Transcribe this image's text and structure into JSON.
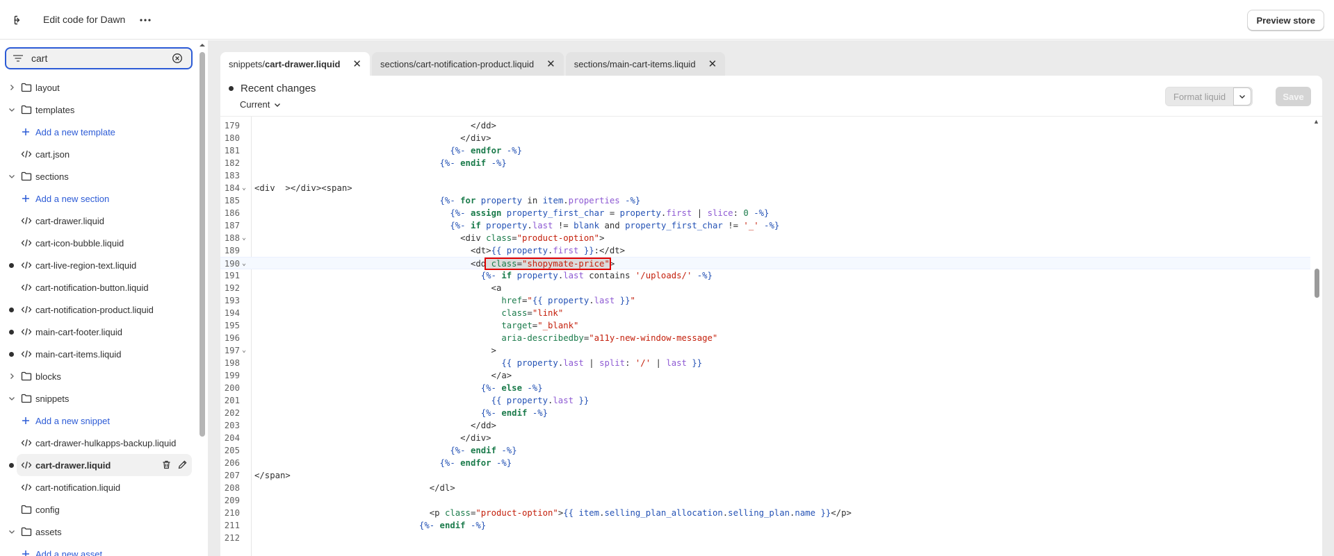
{
  "topbar": {
    "title": "Edit code for Dawn",
    "more_label": "···",
    "preview_label": "Preview store"
  },
  "sidebar": {
    "search_value": "cart",
    "items": [
      {
        "type": "folder",
        "label": "layout",
        "expanded": false,
        "dot": false
      },
      {
        "type": "folder",
        "label": "templates",
        "expanded": true,
        "dot": false
      },
      {
        "type": "add",
        "label": "Add a new template",
        "dot": false
      },
      {
        "type": "file",
        "label": "cart.json",
        "dot": false
      },
      {
        "type": "folder",
        "label": "sections",
        "expanded": true,
        "dot": false
      },
      {
        "type": "add",
        "label": "Add a new section",
        "dot": false
      },
      {
        "type": "file",
        "label": "cart-drawer.liquid",
        "dot": false
      },
      {
        "type": "file",
        "label": "cart-icon-bubble.liquid",
        "dot": false
      },
      {
        "type": "file",
        "label": "cart-live-region-text.liquid",
        "dot": true
      },
      {
        "type": "file",
        "label": "cart-notification-button.liquid",
        "dot": false
      },
      {
        "type": "file",
        "label": "cart-notification-product.liquid",
        "dot": true
      },
      {
        "type": "file",
        "label": "main-cart-footer.liquid",
        "dot": true
      },
      {
        "type": "file",
        "label": "main-cart-items.liquid",
        "dot": true
      },
      {
        "type": "folder",
        "label": "blocks",
        "expanded": false,
        "dot": false
      },
      {
        "type": "folder",
        "label": "snippets",
        "expanded": true,
        "dot": false
      },
      {
        "type": "add",
        "label": "Add a new snippet",
        "dot": false
      },
      {
        "type": "file",
        "label": "cart-drawer-hulkapps-backup.liquid",
        "dot": false
      },
      {
        "type": "file",
        "label": "cart-drawer.liquid",
        "dot": true,
        "active": true
      },
      {
        "type": "file",
        "label": "cart-notification.liquid",
        "dot": false
      },
      {
        "type": "folder",
        "label": "config",
        "expanded": null,
        "dot": false
      },
      {
        "type": "folder",
        "label": "assets",
        "expanded": true,
        "dot": false
      },
      {
        "type": "add",
        "label": "Add a new asset",
        "dot": false
      }
    ]
  },
  "tabs": [
    {
      "prefix": "snippets/",
      "name": "cart-drawer.liquid",
      "active": true
    },
    {
      "prefix": "sections/",
      "name": "cart-notification-product.liquid",
      "active": false
    },
    {
      "prefix": "sections/",
      "name": "main-cart-items.liquid",
      "active": false
    }
  ],
  "editor": {
    "recent_changes": "Recent changes",
    "current_label": "Current",
    "format_label": "Format liquid",
    "save_label": "Save",
    "lines": [
      {
        "n": "179",
        "fold": false,
        "html": "                                          &lt;/dd&gt;"
      },
      {
        "n": "180",
        "fold": false,
        "html": "                                        &lt;/div&gt;"
      },
      {
        "n": "181",
        "fold": false,
        "html": "                                      <span class=\"d\">{%-</span> <span class=\"k\">endfor</span> <span class=\"d\">-%}</span>"
      },
      {
        "n": "182",
        "fold": false,
        "html": "                                    <span class=\"d\">{%-</span> <span class=\"k\">endif</span> <span class=\"d\">-%}</span>"
      },
      {
        "n": "183",
        "fold": false,
        "html": ""
      },
      {
        "n": "184",
        "fold": true,
        "html": "&lt;div  &gt;&lt;/div&gt;&lt;span&gt;"
      },
      {
        "n": "185",
        "fold": false,
        "html": "                                    <span class=\"d\">{%-</span> <span class=\"k\">for</span> <span class=\"d\">property</span> in <span class=\"d\">item</span>.<span class=\"p\">properties</span> <span class=\"d\">-%}</span>"
      },
      {
        "n": "186",
        "fold": false,
        "html": "                                      <span class=\"d\">{%-</span> <span class=\"k\">assign</span> <span class=\"d\">property_first_char</span> = <span class=\"d\">property</span>.<span class=\"p\">first</span> | <span class=\"p\">slice</span>: <span class=\"a\">0</span> <span class=\"d\">-%}</span>"
      },
      {
        "n": "187",
        "fold": false,
        "html": "                                      <span class=\"d\">{%-</span> <span class=\"k\">if</span> <span class=\"d\">property</span>.<span class=\"p\">last</span> != <span class=\"d\">blank</span> and <span class=\"d\">property_first_char</span> != <span class=\"s\">'_'</span> <span class=\"d\">-%}</span>"
      },
      {
        "n": "188",
        "fold": true,
        "html": "                                        &lt;div <span class=\"a\">class</span>=<span class=\"s\">\"product-option\"</span>&gt;"
      },
      {
        "n": "189",
        "fold": false,
        "html": "                                          &lt;dt&gt;<span class=\"d\">{{ property</span>.<span class=\"p\">first</span> <span class=\"d\">}}</span>:&lt;/dt&gt;"
      },
      {
        "n": "190",
        "fold": true,
        "hl": true,
        "html": "                                          &lt;dd<span class=\"sel\"> <span class=\"a\">class</span>=<span class=\"s\">\"shopymate-price\"</span></span>&gt;"
      },
      {
        "n": "191",
        "fold": false,
        "html": "                                            <span class=\"d\">{%-</span> <span class=\"k\">if</span> <span class=\"d\">property</span>.<span class=\"p\">last</span> contains <span class=\"s\">'/uploads/'</span> <span class=\"d\">-%}</span>"
      },
      {
        "n": "192",
        "fold": false,
        "html": "                                              &lt;a"
      },
      {
        "n": "193",
        "fold": false,
        "html": "                                                <span class=\"a\">href</span>=<span class=\"s\">\"</span><span class=\"d\">{{ property</span>.<span class=\"p\">last</span> <span class=\"d\">}}</span><span class=\"s\">\"</span>"
      },
      {
        "n": "194",
        "fold": false,
        "html": "                                                <span class=\"a\">class</span>=<span class=\"s\">\"link\"</span>"
      },
      {
        "n": "195",
        "fold": false,
        "html": "                                                <span class=\"a\">target</span>=<span class=\"s\">\"_blank\"</span>"
      },
      {
        "n": "196",
        "fold": false,
        "html": "                                                <span class=\"a\">aria-describedby</span>=<span class=\"s\">\"a11y-new-window-message\"</span>"
      },
      {
        "n": "197",
        "fold": true,
        "html": "                                              &gt;"
      },
      {
        "n": "198",
        "fold": false,
        "html": "                                                <span class=\"d\">{{ property</span>.<span class=\"p\">last</span> | <span class=\"p\">split</span>: <span class=\"s\">'/'</span> | <span class=\"p\">last</span> <span class=\"d\">}}</span>"
      },
      {
        "n": "199",
        "fold": false,
        "html": "                                              &lt;/a&gt;"
      },
      {
        "n": "200",
        "fold": false,
        "html": "                                            <span class=\"d\">{%-</span> <span class=\"k\">else</span> <span class=\"d\">-%}</span>"
      },
      {
        "n": "201",
        "fold": false,
        "html": "                                              <span class=\"d\">{{ property</span>.<span class=\"p\">last</span> <span class=\"d\">}}</span>"
      },
      {
        "n": "202",
        "fold": false,
        "html": "                                            <span class=\"d\">{%-</span> <span class=\"k\">endif</span> <span class=\"d\">-%}</span>"
      },
      {
        "n": "203",
        "fold": false,
        "html": "                                          &lt;/dd&gt;"
      },
      {
        "n": "204",
        "fold": false,
        "html": "                                        &lt;/div&gt;"
      },
      {
        "n": "205",
        "fold": false,
        "html": "                                      <span class=\"d\">{%-</span> <span class=\"k\">endif</span> <span class=\"d\">-%}</span>"
      },
      {
        "n": "206",
        "fold": false,
        "html": "                                    <span class=\"d\">{%-</span> <span class=\"k\">endfor</span> <span class=\"d\">-%}</span>"
      },
      {
        "n": "207",
        "fold": false,
        "html": "&lt;/span&gt;"
      },
      {
        "n": "208",
        "fold": false,
        "html": "                                  &lt;/dl&gt;"
      },
      {
        "n": "209",
        "fold": false,
        "html": ""
      },
      {
        "n": "210",
        "fold": false,
        "html": "                                  &lt;p <span class=\"a\">class</span>=<span class=\"s\">\"product-option\"</span>&gt;<span class=\"d\">{{ item</span>.<span class=\"d\">selling_plan_allocation</span>.<span class=\"d\">selling_plan</span>.<span class=\"d\">name</span> <span class=\"d\">}}</span>&lt;/p&gt;"
      },
      {
        "n": "211",
        "fold": false,
        "html": "                                <span class=\"d\">{%-</span> <span class=\"k\">endif</span> <span class=\"d\">-%}</span>"
      },
      {
        "n": "212",
        "fold": false,
        "html": ""
      }
    ]
  }
}
